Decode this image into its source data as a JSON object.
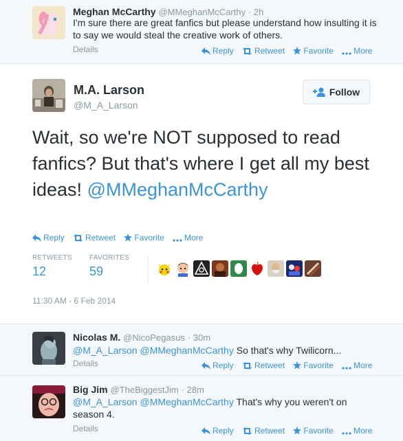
{
  "actions": {
    "reply": "Reply",
    "retweet": "Retweet",
    "favorite": "Favorite",
    "more": "More"
  },
  "tweet_top": {
    "name": "Meghan McCarthy",
    "handle": "@MMeghanMcCarthy",
    "time": "· 2h",
    "text": "I'm sure there are great fanfics but please understand how insulting it is to say we would steal the creative work of others.",
    "details": "Details"
  },
  "main_tweet": {
    "name": "M.A. Larson",
    "handle": "@M_A_Larson",
    "follow_label": "Follow",
    "text_body": "Wait, so we're NOT supposed to read fanfics? But that's where I get all my best ideas!",
    "text_mention": "@MMeghanMcCarthy",
    "retweets_label": "RETWEETS",
    "retweets_count": "12",
    "favorites_label": "FAVORITES",
    "favorites_count": "59",
    "timestamp": "11:30 AM - 6 Feb 2014"
  },
  "reply_1": {
    "name": "Nicolas M.",
    "handle": "@NicoPegasus",
    "time": "· 30m",
    "mention1": "@M_A_Larson",
    "mention2": "@MMeghanMcCarthy",
    "text": "So that's why Twilicorn...",
    "details": "Details"
  },
  "reply_2": {
    "name": "Big Jim",
    "handle": "@TheBiggestJim",
    "time": "· 28m",
    "mention1": "@M_A_Larson",
    "mention2": "@MMeghanMcCarthy",
    "text_line1": "That's why you weren't on",
    "text_line2": "season 4.",
    "details": "Details"
  },
  "colors": {
    "link": "#3b94d9",
    "muted": "#8899a6",
    "text": "#292f33",
    "bg_reply": "#f5f8fa",
    "border": "#e1e8ed"
  }
}
